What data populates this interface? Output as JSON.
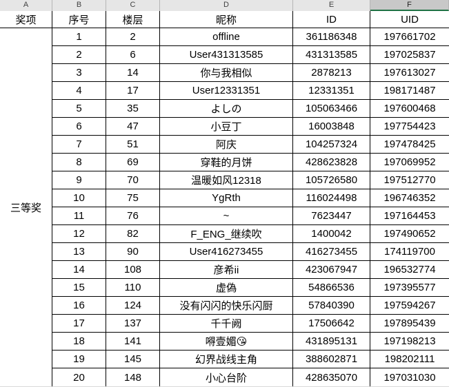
{
  "spreadsheet": {
    "column_letters": [
      "A",
      "B",
      "C",
      "D",
      "E",
      "F"
    ],
    "selected_column": "F",
    "selected_column_accent": "#1f7244",
    "headers": {
      "a": "奖项",
      "b": "序号",
      "c": "楼层",
      "d": "昵称",
      "e": "ID",
      "f": "UID"
    },
    "award_label": "三等奖",
    "rows": [
      {
        "index": "1",
        "floor": "2",
        "nickname": "offline",
        "id": "361186348",
        "uid": "197661702"
      },
      {
        "index": "2",
        "floor": "6",
        "nickname": "User431313585",
        "id": "431313585",
        "uid": "197025837"
      },
      {
        "index": "3",
        "floor": "14",
        "nickname": "你与我相似",
        "id": "2878213",
        "uid": "197613027"
      },
      {
        "index": "4",
        "floor": "17",
        "nickname": "User12331351",
        "id": "12331351",
        "uid": "198171487"
      },
      {
        "index": "5",
        "floor": "35",
        "nickname": "よしの",
        "id": "105063466",
        "uid": "197600468"
      },
      {
        "index": "6",
        "floor": "47",
        "nickname": "小豆丁",
        "id": "16003848",
        "uid": "197754423"
      },
      {
        "index": "7",
        "floor": "51",
        "nickname": "阿庆",
        "id": "104257324",
        "uid": "197478425"
      },
      {
        "index": "8",
        "floor": "69",
        "nickname": "穿鞋的月饼",
        "id": "428623828",
        "uid": "197069952"
      },
      {
        "index": "9",
        "floor": "70",
        "nickname": "温暖如风12318",
        "id": "105726580",
        "uid": "197512770"
      },
      {
        "index": "10",
        "floor": "75",
        "nickname": "YgRth",
        "id": "116024498",
        "uid": "196746352"
      },
      {
        "index": "11",
        "floor": "76",
        "nickname": "~",
        "id": "7623447",
        "uid": "197164453"
      },
      {
        "index": "12",
        "floor": "82",
        "nickname": "F_ENG_继续吹",
        "id": "1400042",
        "uid": "197490652"
      },
      {
        "index": "13",
        "floor": "90",
        "nickname": "User416273455",
        "id": "416273455",
        "uid": "174119700"
      },
      {
        "index": "14",
        "floor": "108",
        "nickname": "彦希ii",
        "id": "423067947",
        "uid": "196532774"
      },
      {
        "index": "15",
        "floor": "110",
        "nickname": "虚偽",
        "id": "54866536",
        "uid": "197395577"
      },
      {
        "index": "16",
        "floor": "124",
        "nickname": "没有闪闪的快乐闪厨",
        "id": "57840390",
        "uid": "197594267"
      },
      {
        "index": "17",
        "floor": "137",
        "nickname": "千千阙",
        "id": "17506642",
        "uid": "197895439"
      },
      {
        "index": "18",
        "floor": "141",
        "nickname": "嘚壹媚😘",
        "id": "431895131",
        "uid": "197198213"
      },
      {
        "index": "19",
        "floor": "145",
        "nickname": "幻界战线主角",
        "id": "388602871",
        "uid": "198202111"
      },
      {
        "index": "20",
        "floor": "148",
        "nickname": "小心台阶",
        "id": "428635070",
        "uid": "197031030"
      }
    ]
  }
}
